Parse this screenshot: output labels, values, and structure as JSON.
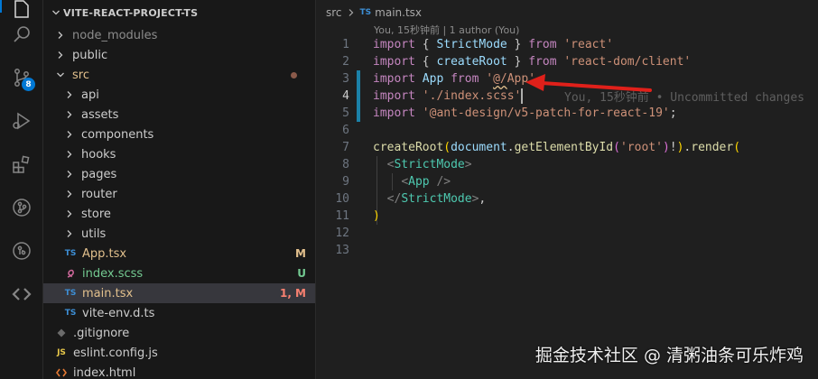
{
  "activity_bar": {
    "items": [
      {
        "name": "explorer-icon"
      },
      {
        "name": "search-icon"
      },
      {
        "name": "source-control-icon",
        "badge": "8"
      },
      {
        "name": "run-debug-icon"
      },
      {
        "name": "extensions-icon"
      },
      {
        "name": "git-graph-icon"
      },
      {
        "name": "docker-icon"
      },
      {
        "name": "remote-icon"
      }
    ]
  },
  "explorer": {
    "project_title": "VITE-REACT-PROJECT-TS",
    "items": [
      {
        "label": "node_modules",
        "type": "folder",
        "depth": 1,
        "color": "#8c8c8c"
      },
      {
        "label": "public",
        "type": "folder",
        "depth": 1,
        "color": "#cccccc"
      },
      {
        "label": "src",
        "type": "folder-open",
        "depth": 1,
        "color": "#e2c08d",
        "dot": true
      },
      {
        "label": "api",
        "type": "folder",
        "depth": 2,
        "color": "#cccccc"
      },
      {
        "label": "assets",
        "type": "folder",
        "depth": 2,
        "color": "#cccccc"
      },
      {
        "label": "components",
        "type": "folder",
        "depth": 2,
        "color": "#cccccc"
      },
      {
        "label": "hooks",
        "type": "folder",
        "depth": 2,
        "color": "#cccccc"
      },
      {
        "label": "pages",
        "type": "folder",
        "depth": 2,
        "color": "#cccccc"
      },
      {
        "label": "router",
        "type": "folder",
        "depth": 2,
        "color": "#cccccc"
      },
      {
        "label": "store",
        "type": "folder",
        "depth": 2,
        "color": "#cccccc"
      },
      {
        "label": "utils",
        "type": "folder",
        "depth": 2,
        "color": "#cccccc"
      },
      {
        "label": "App.tsx",
        "type": "ts",
        "depth": 2,
        "color": "#e2c08d",
        "badge": "M"
      },
      {
        "label": "index.scss",
        "type": "scss",
        "depth": 2,
        "color": "#73c991",
        "badge": "U"
      },
      {
        "label": "main.tsx",
        "type": "ts",
        "depth": 2,
        "color": "#e2c08d",
        "badge": "1, M",
        "badge_color": "#f88070",
        "selected": true
      },
      {
        "label": "vite-env.d.ts",
        "type": "ts",
        "depth": 2,
        "color": "#cccccc"
      },
      {
        "label": ".gitignore",
        "type": "git",
        "depth": 1,
        "color": "#cccccc"
      },
      {
        "label": "eslint.config.js",
        "type": "js",
        "depth": 1,
        "color": "#cccccc"
      },
      {
        "label": "index.html",
        "type": "html",
        "depth": 1,
        "color": "#cccccc"
      }
    ]
  },
  "editor": {
    "breadcrumb": {
      "folder": "src",
      "file_icon": "TS",
      "file": "main.tsx"
    },
    "codelens": "You, 15秒钟前 | 1 author (You)",
    "blame": "You, 15秒钟前 • Uncommitted changes",
    "line_numbers": [
      "1",
      "2",
      "3",
      "4",
      "5",
      "6",
      "7",
      "8",
      "9",
      "10",
      "11",
      "12",
      "13"
    ],
    "active_line": "4",
    "lines": {
      "l1": {
        "kw1": "import",
        "p1": " { ",
        "id1": "StrictMode",
        "p2": " } ",
        "kw2": "from",
        "s1": " ",
        "st": "'react'"
      },
      "l2": {
        "kw1": "import",
        "p1": " { ",
        "id1": "createRoot",
        "p2": " } ",
        "kw2": "from",
        "s1": " ",
        "st": "'react-dom/client'"
      },
      "l3": {
        "kw1": "import",
        "id1": " App ",
        "kw2": "from",
        "s1": " ",
        "st_a": "'",
        "st_b": "@/",
        "st_c": "App'"
      },
      "l4": {
        "kw1": "import",
        "s1": " ",
        "st": "'./index.scss'"
      },
      "l5": {
        "kw1": "import",
        "s1": " ",
        "st": "'@ant-design/v5-patch-for-react-19'",
        "p": ";"
      },
      "l7": {
        "fn1": "createRoot",
        "b1": "(",
        "id1": "document",
        "p1": ".",
        "fn2": "getElementById",
        "b2": "(",
        "st": "'root'",
        "b3": ")",
        "p2": "!",
        "b4": ")",
        "p3": ".",
        "fn3": "render",
        "b5": "("
      },
      "l8": {
        "lt": "<",
        "ty": "StrictMode",
        "gt": ">"
      },
      "l9": {
        "lt": "<",
        "ty": "App",
        "gt": " />"
      },
      "l10": {
        "lt": "</",
        "ty": "StrictMode",
        "gt": ">",
        "p": ","
      },
      "l11": {
        "b": ")"
      }
    }
  },
  "watermark": "掘金技术社区 @ 清粥油条可乐炸鸡",
  "colors": {
    "accent": "#0078d4",
    "modified": "#e2c08d",
    "untracked": "#73c991",
    "error": "#f88070",
    "annotation_arrow": "#e0201a"
  }
}
